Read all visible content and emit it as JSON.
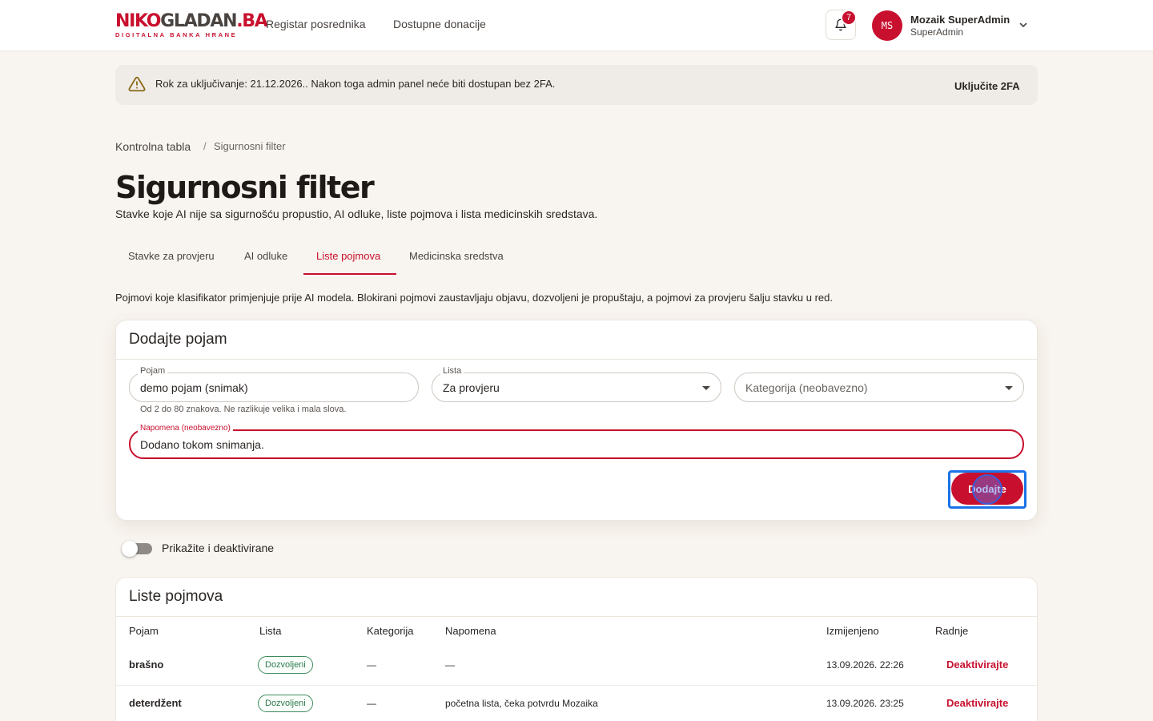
{
  "header": {
    "logo": {
      "part1": "NIKO",
      "part2": "GLADAN",
      "part3": ".BA",
      "tagline": "DIGITALNA BANKA HRANE"
    },
    "nav": [
      "Registar posrednika",
      "Dostupne donacije"
    ],
    "notifications_count": "7",
    "user": {
      "initials": "MS",
      "name": "Mozaik SuperAdmin",
      "role": "SuperAdmin"
    }
  },
  "alert": {
    "text": "Rok za uključivanje: 21.12.2026.. Nakon toga admin panel neće biti dostupan bez 2FA.",
    "action": "Uključite 2FA"
  },
  "breadcrumb": {
    "home": "Kontrolna tabla",
    "separator": "/",
    "current": "Sigurnosni filter"
  },
  "page": {
    "title": "Sigurnosni filter",
    "subtitle": "Stavke koje AI nije sa sigurnošću propustio, AI odluke, liste pojmova i lista medicinskih sredstava."
  },
  "tabs": [
    {
      "label": "Stavke za provjeru"
    },
    {
      "label": "AI odluke"
    },
    {
      "label": "Liste pojmova",
      "active": true
    },
    {
      "label": "Medicinska sredstva"
    }
  ],
  "intro": "Pojmovi koje klasifikator primjenjuje prije AI modela. Blokirani pojmovi zaustavljaju objavu, dozvoljeni je propuštaju, a pojmovi za provjeru šalju stavku u red.",
  "add_form": {
    "title": "Dodajte pojam",
    "term": {
      "label": "Pojam",
      "value": "demo pojam (snimak)",
      "hint": "Od 2 do 80 znakova. Ne razlikuje velika i mala slova."
    },
    "list": {
      "label": "Lista",
      "value": "Za provjeru"
    },
    "category": {
      "placeholder": "Kategorija (neobavezno)"
    },
    "note": {
      "label": "Napomena (neobavezno)",
      "value": "Dodano tokom snimanja."
    },
    "submit": "Dodajte"
  },
  "toggle": {
    "label": "Prikažite i deaktivirane",
    "on": false
  },
  "table": {
    "title": "Liste pojmova",
    "columns": [
      "Pojam",
      "Lista",
      "Kategorija",
      "Napomena",
      "Izmijenjeno",
      "Radnje"
    ],
    "rows": [
      {
        "term": "brašno",
        "list": "Dozvoljeni",
        "category": "—",
        "note": "—",
        "modified": "13.09.2026. 22:26",
        "action": "Deaktivirajte"
      },
      {
        "term": "deterdžent",
        "list": "Dozvoljeni",
        "category": "—",
        "note": "početna lista, čeka potvrdu Mozaika",
        "modified": "13.09.2026. 23:25",
        "action": "Deaktivirajte"
      }
    ]
  },
  "colors": {
    "brand": "#c8102e",
    "background": "#f8f4ef",
    "success": "#2d7a4c"
  }
}
